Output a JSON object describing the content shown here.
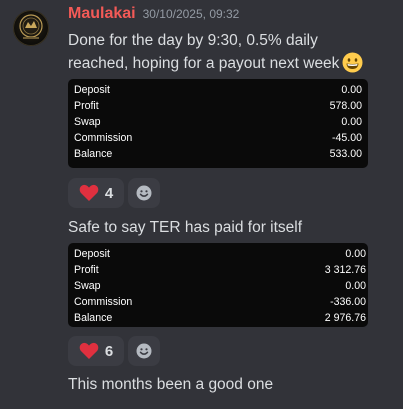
{
  "author": {
    "username": "Maulakai",
    "timestamp": "30/10/2025, 09:32"
  },
  "messages": [
    {
      "text_line1": "Done for the day by 9:30, 0.5% daily",
      "text_line2": "reached, hoping for a payout next week",
      "emoji": "grinning-face-emoji",
      "attachment": {
        "rows": [
          {
            "label": "Deposit",
            "value": "0.00"
          },
          {
            "label": "Profit",
            "value": "578.00"
          },
          {
            "label": "Swap",
            "value": "0.00"
          },
          {
            "label": "Commission",
            "value": "-45.00"
          },
          {
            "label": "Balance",
            "value": "533.00"
          }
        ]
      },
      "reaction": {
        "icon": "heart-icon",
        "count": "4"
      }
    },
    {
      "text": "Safe to say TER has paid for itself",
      "attachment": {
        "rows": [
          {
            "label": "Deposit",
            "value": "0.00"
          },
          {
            "label": "Profit",
            "value": "3 312.76"
          },
          {
            "label": "Swap",
            "value": "0.00"
          },
          {
            "label": "Commission",
            "value": "-336.00"
          },
          {
            "label": "Balance",
            "value": "2 976.76"
          }
        ]
      },
      "reaction": {
        "icon": "heart-icon",
        "count": "6"
      }
    },
    {
      "text": "This months been a good one"
    }
  ],
  "add_reaction_icon": "smiley-add-reaction-icon",
  "colors": {
    "background": "#323339",
    "username": "#f35a57",
    "timestamp": "#949ba4",
    "reaction_bg": "#3b3c43",
    "heart": "#e0303f"
  }
}
